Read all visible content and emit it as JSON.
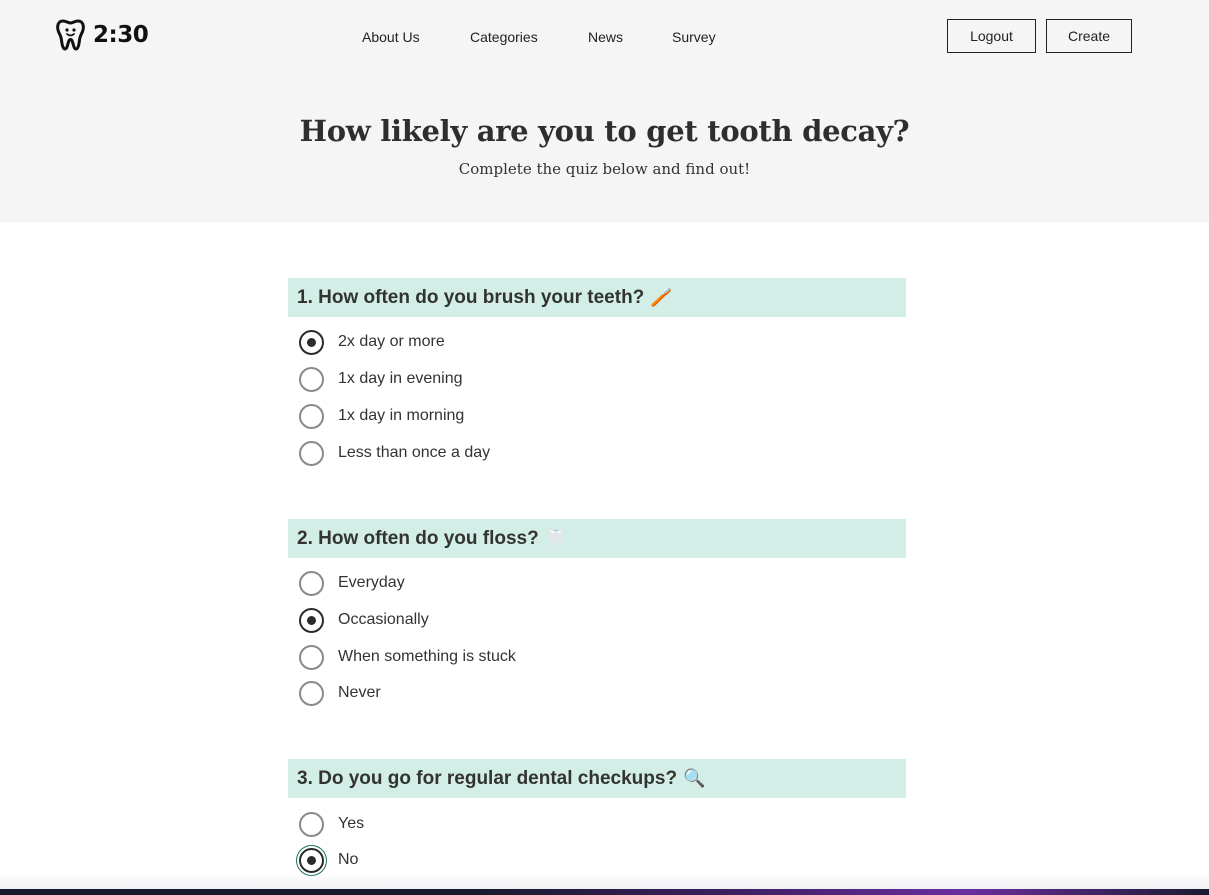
{
  "brand": {
    "logo_text": "2:30",
    "logo_icon": "tooth-icon"
  },
  "nav": {
    "items": [
      "About Us",
      "Categories",
      "News",
      "Survey"
    ]
  },
  "header_buttons": {
    "logout": "Logout",
    "create": "Create"
  },
  "hero": {
    "title": "How likely are you to get tooth decay?",
    "subtitle": "Complete the quiz below and find out!"
  },
  "questions": [
    {
      "heading": "1. How often do you brush your teeth?",
      "emoji": "🪥",
      "options": [
        "2x day or more",
        "1x day in evening",
        "1x day in morning",
        "Less than once a day"
      ],
      "selected": "2x day or more"
    },
    {
      "heading": "2. How often do you floss?",
      "emoji": "🦷",
      "options": [
        "Everyday",
        "Occasionally",
        "When something is stuck",
        "Never"
      ],
      "selected": "Occasionally"
    },
    {
      "heading": "3. Do you go for regular dental checkups?",
      "emoji": "🔍",
      "options": [
        "Yes",
        "No"
      ],
      "selected": "No"
    }
  ],
  "colors": {
    "header_bg": "#f5f5f5",
    "question_bg": "#d3eee7",
    "focus_ring": "#1e6f60"
  }
}
